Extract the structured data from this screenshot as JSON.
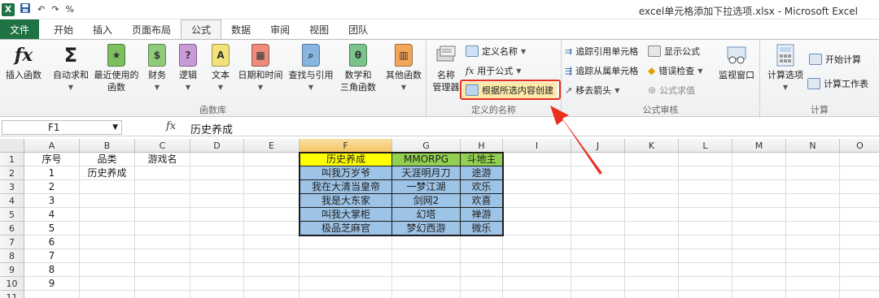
{
  "title_bar": {
    "logo": "X",
    "undo": "↶",
    "redo": "↷",
    "percent": "%",
    "window_title": "excel单元格添加下拉选项.xlsx - Microsoft Excel"
  },
  "tabs": [
    "文件",
    "开始",
    "插入",
    "页面布局",
    "公式",
    "数据",
    "审阅",
    "视图",
    "团队"
  ],
  "active_tab": "公式",
  "ribbon": {
    "function_library": {
      "label": "函数库",
      "buttons": [
        "插入函数",
        "自动求和",
        "最近使用的\n函数",
        "财务",
        "逻辑",
        "文本",
        "日期和时间",
        "查找与引用",
        "数学和\n三角函数",
        "其他函数"
      ]
    },
    "defined_names": {
      "label": "定义的名称",
      "name_manager": "名称\n管理器",
      "define_name": "定义名称",
      "use_in_formula": "用于公式",
      "create_from_selection": "根据所选内容创建"
    },
    "formula_auditing": {
      "label": "公式审核",
      "trace_precedents": "追踪引用单元格",
      "trace_dependents": "追踪从属单元格",
      "remove_arrows": "移去箭头",
      "show_formulas": "显示公式",
      "error_checking": "错误检查",
      "evaluate_formula": "公式求值",
      "watch_window": "监视窗口"
    },
    "calculation": {
      "label": "计算",
      "calc_options": "计算选项",
      "calc_now": "开始计算",
      "calc_sheet": "计算工作表"
    }
  },
  "formula_bar": {
    "name_box": "F1",
    "fx": "fx",
    "value": "历史养成"
  },
  "columns": [
    "A",
    "B",
    "C",
    "D",
    "E",
    "F",
    "G",
    "H",
    "I",
    "J",
    "K",
    "L",
    "M",
    "N",
    "O"
  ],
  "rows": [
    "1",
    "2",
    "3",
    "4",
    "5",
    "6",
    "7",
    "8",
    "9",
    "10",
    "11"
  ],
  "cells": {
    "A1": "序号",
    "B1": "品类",
    "C1": "游戏名",
    "A2": "1",
    "B2": "历史养成",
    "A3": "2",
    "A4": "3",
    "A5": "4",
    "A6": "5",
    "A7": "6",
    "A8": "7",
    "A9": "8",
    "A10": "9",
    "F1": "历史养成",
    "G1": "MMORPG",
    "H1": "斗地主",
    "F2": "叫我万岁爷",
    "G2": "天涯明月刀",
    "H2": "途游",
    "F3": "我在大清当皇帝",
    "G3": "一梦江湖",
    "H3": "欢乐",
    "F4": "我是大东家",
    "G4": "剑网2",
    "H4": "欢喜",
    "F5": "叫我大掌柜",
    "G5": "幻塔",
    "H5": "禅游",
    "F6": "极品芝麻官",
    "G6": "梦幻西游",
    "H6": "微乐"
  },
  "colors": {
    "excel_green": "#1f7244",
    "header_yellow": "#ffff00",
    "header_green": "#92d050",
    "data_blue": "#9dc3e6",
    "annotation_red": "#e8301f"
  }
}
